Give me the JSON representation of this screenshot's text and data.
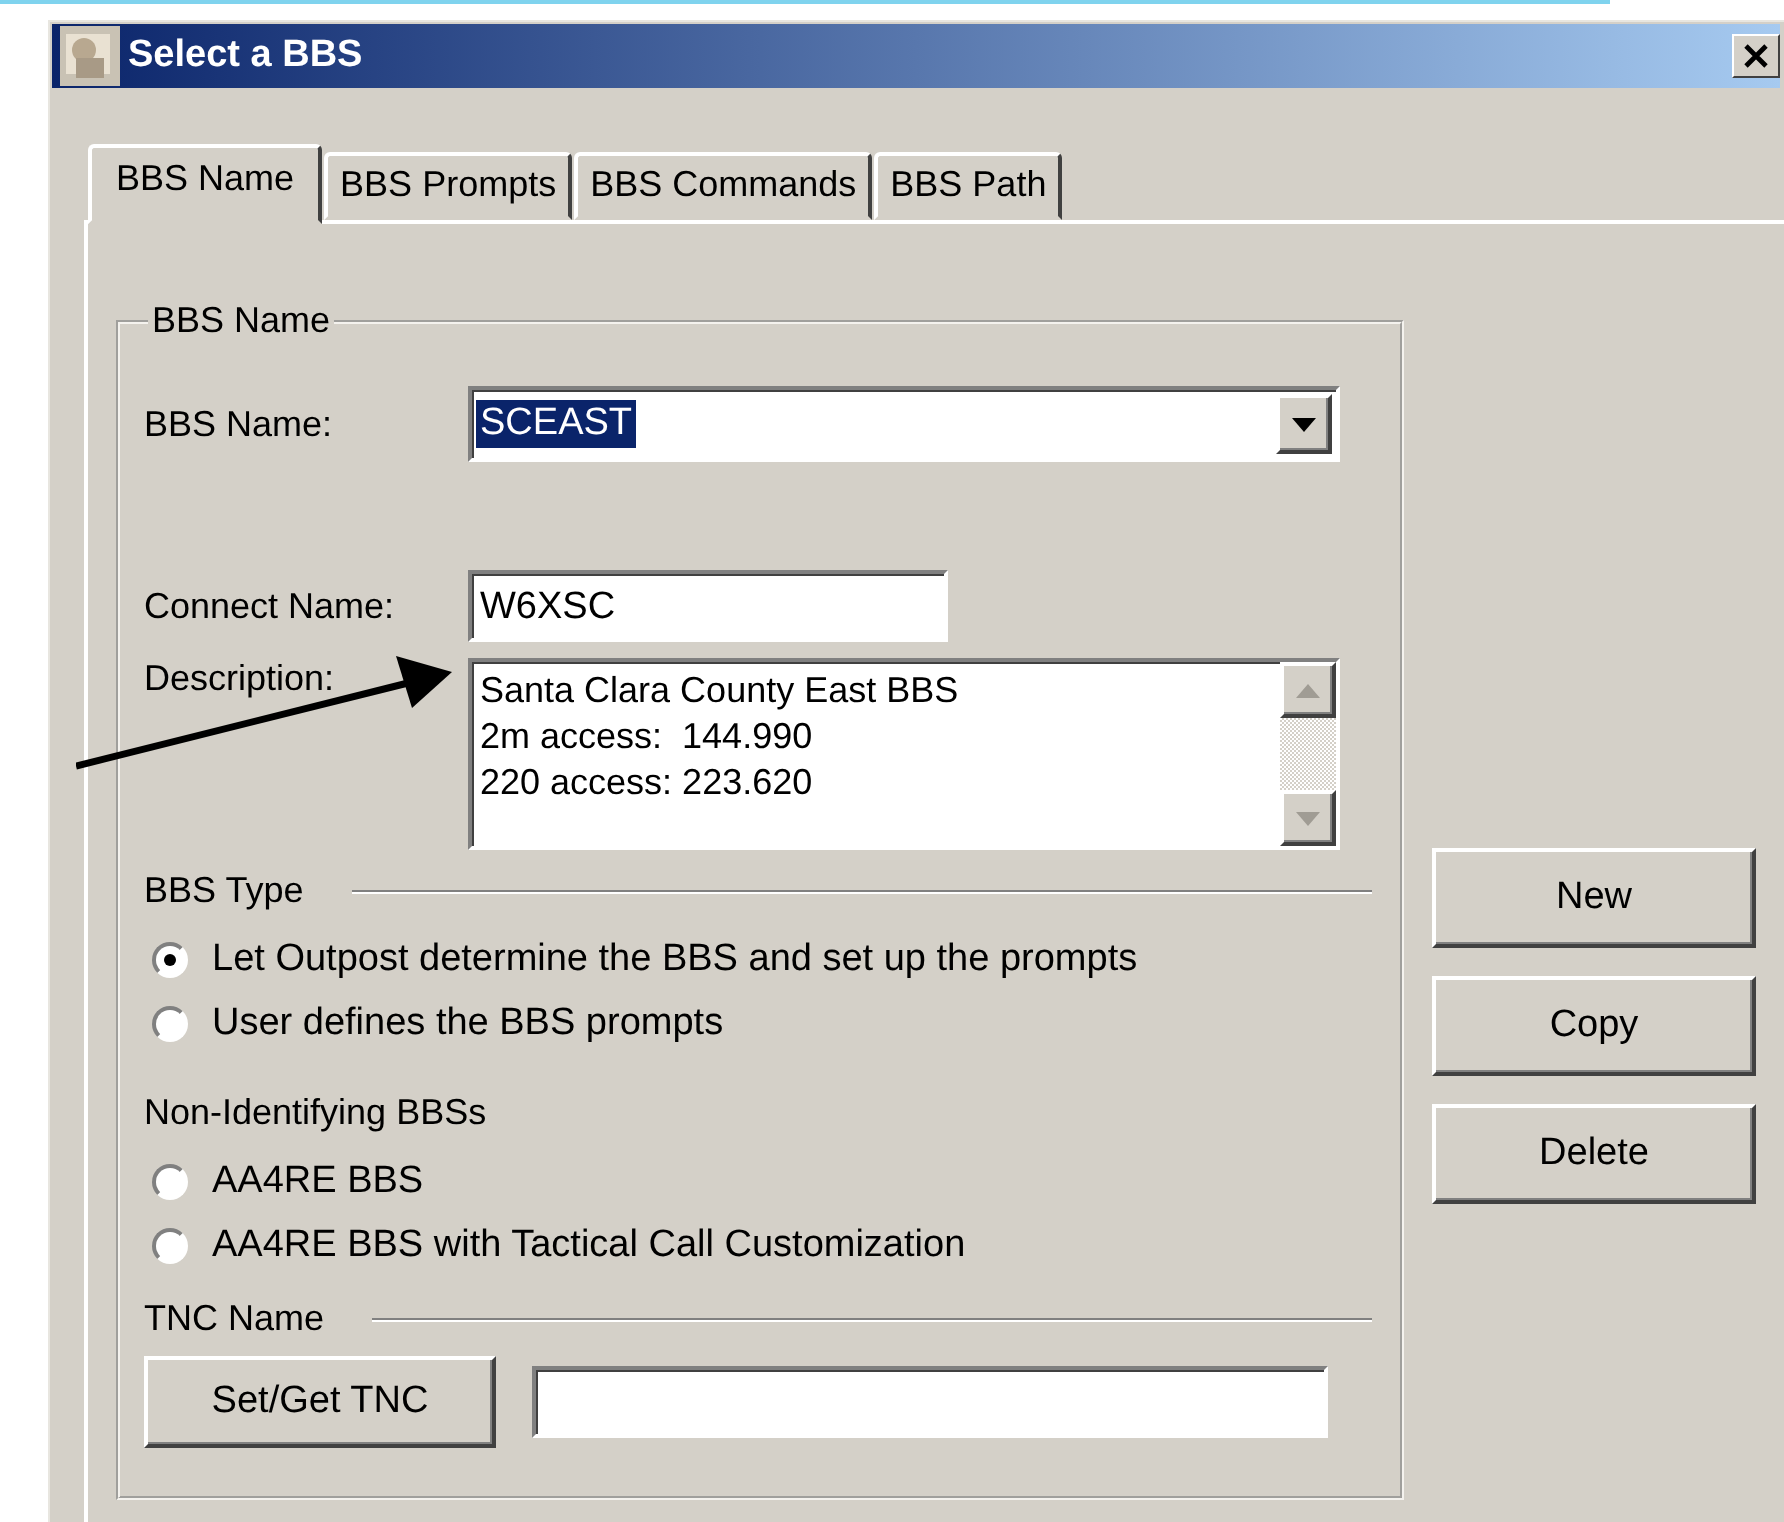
{
  "window": {
    "title": "Select a BBS"
  },
  "tabs": [
    {
      "label": "BBS Name",
      "selected": true
    },
    {
      "label": "BBS Prompts",
      "selected": false
    },
    {
      "label": "BBS Commands",
      "selected": false
    },
    {
      "label": "BBS Path",
      "selected": false
    }
  ],
  "group": {
    "title": "BBS Name"
  },
  "bbs_name": {
    "label": "BBS Name:",
    "value": "SCEAST",
    "highlighted": true
  },
  "connect_name": {
    "label": "Connect Name:",
    "value": "W6XSC"
  },
  "description": {
    "label": "Description:",
    "lines": [
      "Santa Clara County East BBS",
      "2m access:  144.990",
      "220 access: 223.620"
    ]
  },
  "bbs_type": {
    "title": "BBS Type",
    "options": [
      {
        "label": "Let Outpost determine the BBS and set up the prompts",
        "selected": true
      },
      {
        "label": "User defines the BBS prompts",
        "selected": false
      }
    ]
  },
  "non_identifying": {
    "title": "Non-Identifying BBSs",
    "options": [
      {
        "label": "AA4RE BBS",
        "selected": false
      },
      {
        "label": "AA4RE BBS with Tactical Call Customization",
        "selected": false
      }
    ]
  },
  "tnc": {
    "title": "TNC Name",
    "button": "Set/Get TNC"
  },
  "buttons": [
    "New",
    "Copy",
    "Delete"
  ]
}
